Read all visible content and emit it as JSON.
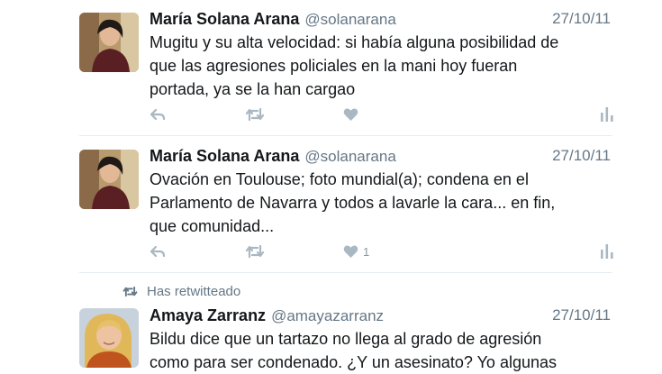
{
  "tweets": [
    {
      "name": "María Solana Arana",
      "handle": "@solanarana",
      "date": "27/10/11",
      "text": "Mugitu y su alta velocidad: si había alguna posibilidad de\nque las agresiones policiales en la mani hoy fueran\nportada, ya se la han cargao",
      "like_count": ""
    },
    {
      "name": "María Solana Arana",
      "handle": "@solanarana",
      "date": "27/10/11",
      "text": "Ovación en Toulouse; foto mundial(a); condena en el\nParlamento de Navarra y todos a lavarle la cara... en fin,\nque comunidad...",
      "like_count": "1"
    },
    {
      "retweet_label": "Has retwitteado",
      "name": "Amaya Zarranz",
      "handle": "@amayazarranz",
      "date": "27/10/11",
      "text": "Bildu dice que un tartazo no llega al grado de agresión\ncomo para ser condenado. ¿Y un asesinato? Yo algunas"
    }
  ],
  "icons": {
    "reply": "reply-icon",
    "retweet": "retweet-icon",
    "like": "heart-icon",
    "analytics": "analytics-icon"
  },
  "colors": {
    "icon_gray": "#aab8c2",
    "text_secondary": "#657786",
    "separator": "#e6ecf0"
  }
}
